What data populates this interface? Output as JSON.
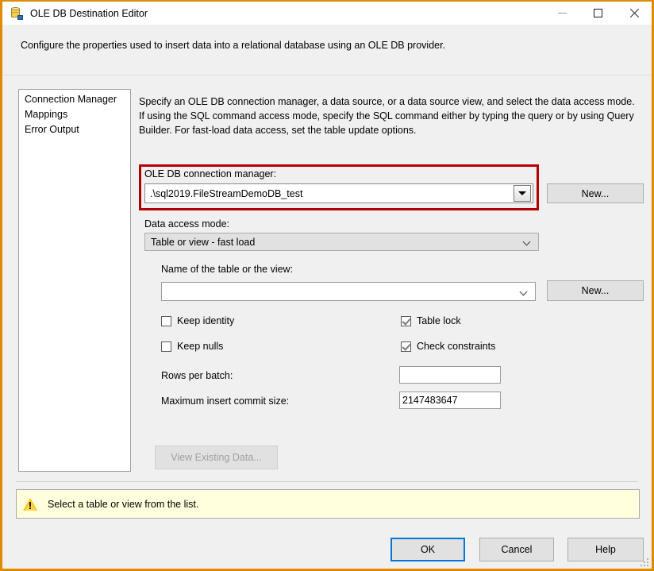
{
  "window": {
    "title": "OLE DB Destination Editor",
    "icon": "database-destination-icon",
    "accent_border": "#e08a00",
    "minimize_label": "Minimize",
    "maximize_label": "Maximize",
    "close_label": "Close"
  },
  "header": {
    "description": "Configure the properties used to insert data into a relational database using an OLE DB provider."
  },
  "sidebar": {
    "items": [
      {
        "label": "Connection Manager",
        "selected": true
      },
      {
        "label": "Mappings",
        "selected": false
      },
      {
        "label": "Error Output",
        "selected": false
      }
    ],
    "selected_color": "#0078d7"
  },
  "main": {
    "instructions": "Specify an OLE DB connection manager, a data source, or a data source view, and select the data access mode. If using the SQL command access mode, specify the SQL command either by typing the query or by using Query Builder. For fast-load data access, set the table update options.",
    "highlight_color": "#b50000",
    "connection_manager": {
      "label": "OLE DB connection manager:",
      "value": ".\\sql2019.FileStreamDemoDB_test",
      "new_button": "New..."
    },
    "data_access_mode": {
      "label": "Data access mode:",
      "value": "Table or view - fast load"
    },
    "table_or_view": {
      "label": "Name of the table or the view:",
      "value": "",
      "new_button": "New..."
    },
    "checkboxes": [
      {
        "label": "Keep identity",
        "checked": false
      },
      {
        "label": "Keep nulls",
        "checked": false
      },
      {
        "label": "Table lock",
        "checked": true
      },
      {
        "label": "Check constraints",
        "checked": true
      }
    ],
    "rows_per_batch": {
      "label": "Rows per batch:",
      "value": ""
    },
    "maximum_insert_commit_size": {
      "label": "Maximum insert commit size:",
      "value": "2147483647"
    },
    "view_existing_data_button": {
      "label": "View Existing Data...",
      "enabled": false
    }
  },
  "warning": {
    "icon": "warning-triangle-icon",
    "message": "Select a table or view from the list.",
    "background": "#ffffdd"
  },
  "footer": {
    "ok_label": "OK",
    "cancel_label": "Cancel",
    "help_label": "Help",
    "default_button_outline": "#0078d7"
  }
}
